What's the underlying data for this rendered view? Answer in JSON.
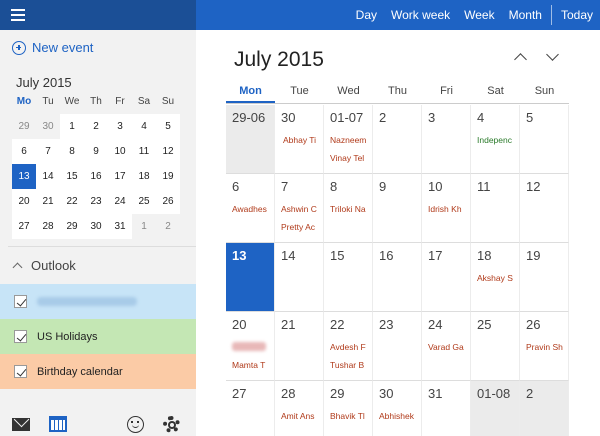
{
  "topbar": {
    "views": [
      "Day",
      "Work week",
      "Week",
      "Month",
      "Today"
    ]
  },
  "sidebar": {
    "new_event": "New event",
    "mini_calendar": {
      "title": "July 2015",
      "weekdays": [
        "Mo",
        "Tu",
        "We",
        "Th",
        "Fr",
        "Sa",
        "Su"
      ],
      "days": [
        {
          "d": "29",
          "other": true
        },
        {
          "d": "30",
          "other": true
        },
        {
          "d": "1"
        },
        {
          "d": "2"
        },
        {
          "d": "3"
        },
        {
          "d": "4"
        },
        {
          "d": "5"
        },
        {
          "d": "6"
        },
        {
          "d": "7"
        },
        {
          "d": "8"
        },
        {
          "d": "9"
        },
        {
          "d": "10"
        },
        {
          "d": "11"
        },
        {
          "d": "12"
        },
        {
          "d": "13",
          "today": true
        },
        {
          "d": "14"
        },
        {
          "d": "15"
        },
        {
          "d": "16"
        },
        {
          "d": "17"
        },
        {
          "d": "18"
        },
        {
          "d": "19"
        },
        {
          "d": "20"
        },
        {
          "d": "21"
        },
        {
          "d": "22"
        },
        {
          "d": "23"
        },
        {
          "d": "24"
        },
        {
          "d": "25"
        },
        {
          "d": "26"
        },
        {
          "d": "27"
        },
        {
          "d": "28"
        },
        {
          "d": "29"
        },
        {
          "d": "30"
        },
        {
          "d": "31"
        },
        {
          "d": "1",
          "other": true
        },
        {
          "d": "2",
          "other": true
        }
      ]
    },
    "group_label": "Outlook",
    "calendars": [
      {
        "label": "",
        "color": "#c7e4f7",
        "blurred": true
      },
      {
        "label": "US Holidays",
        "color": "#c4e7b4"
      },
      {
        "label": "Birthday calendar",
        "color": "#fbcba6"
      }
    ],
    "bottom_icons": [
      "mail-icon",
      "calendar-icon",
      "smiley-icon",
      "gear-icon"
    ]
  },
  "main": {
    "title": "July 2015",
    "weekdays": [
      "Mon",
      "Tue",
      "Wed",
      "Thu",
      "Fri",
      "Sat",
      "Sun"
    ],
    "weeks": [
      [
        {
          "d": "29-06",
          "other": true
        },
        {
          "d": "30",
          "events": [
            {
              "text": "Abhay Ti",
              "boxed": true
            }
          ]
        },
        {
          "d": "01-07",
          "events": [
            {
              "text": "Nazneem"
            },
            {
              "text": "Vinay Tel"
            }
          ]
        },
        {
          "d": "2"
        },
        {
          "d": "3"
        },
        {
          "d": "4",
          "events": [
            {
              "text": "Indepenc",
              "green": true
            }
          ]
        },
        {
          "d": "5"
        }
      ],
      [
        {
          "d": "6",
          "events": [
            {
              "text": "Awadhes"
            }
          ]
        },
        {
          "d": "7",
          "events": [
            {
              "text": "Ashwin C"
            },
            {
              "text": "Pretty Ac"
            }
          ]
        },
        {
          "d": "8",
          "events": [
            {
              "text": "Triloki Na"
            }
          ]
        },
        {
          "d": "9"
        },
        {
          "d": "10",
          "events": [
            {
              "text": "Idrish Kh"
            }
          ]
        },
        {
          "d": "11"
        },
        {
          "d": "12"
        }
      ],
      [
        {
          "d": "13",
          "today": true
        },
        {
          "d": "14"
        },
        {
          "d": "15"
        },
        {
          "d": "16"
        },
        {
          "d": "17"
        },
        {
          "d": "18",
          "events": [
            {
              "text": "Akshay S"
            }
          ]
        },
        {
          "d": "19"
        }
      ],
      [
        {
          "d": "20",
          "blur": true,
          "events": [
            {
              "text": "Mamta T",
              "slot": "second"
            }
          ]
        },
        {
          "d": "21"
        },
        {
          "d": "22",
          "events": [
            {
              "text": "Avdesh F"
            },
            {
              "text": "Tushar B"
            }
          ]
        },
        {
          "d": "23"
        },
        {
          "d": "24",
          "events": [
            {
              "text": "Varad Ga"
            }
          ]
        },
        {
          "d": "25"
        },
        {
          "d": "26",
          "events": [
            {
              "text": "Pravin Sh"
            }
          ]
        }
      ],
      [
        {
          "d": "27"
        },
        {
          "d": "28",
          "events": [
            {
              "text": "Amit Ans"
            }
          ]
        },
        {
          "d": "29",
          "events": [
            {
              "text": "Bhavik Tl"
            }
          ]
        },
        {
          "d": "30",
          "events": [
            {
              "text": "Abhishek"
            }
          ]
        },
        {
          "d": "31"
        },
        {
          "d": "01-08",
          "other": true
        },
        {
          "d": "2",
          "other": true
        }
      ]
    ]
  }
}
